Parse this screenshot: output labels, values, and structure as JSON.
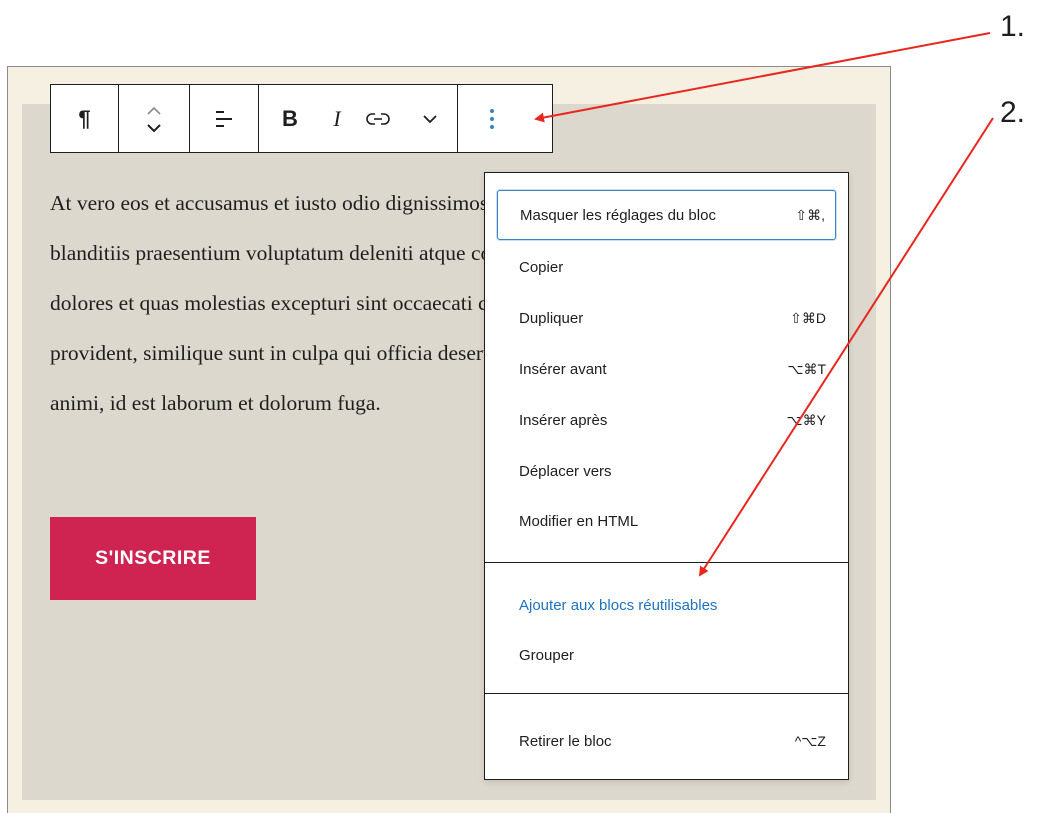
{
  "annotations": {
    "step1": "1.",
    "step2": "2."
  },
  "toolbar": {
    "paragraph_icon": "¶",
    "bold_label": "B",
    "italic_label": "I"
  },
  "paragraph": {
    "lines": [
      "At vero eos et accusamus et iusto odio dignissimos ducimus qui",
      "blanditiis praesentium voluptatum deleniti atque corrupti quos",
      "dolores et quas molestias excepturi sint occaecati cupiditate non",
      "provident, similique sunt in culpa qui officia deserunt mollitia",
      "animi, id est laborum et dolorum fuga."
    ]
  },
  "button": {
    "label": "S'INSCRIRE"
  },
  "menu": {
    "items": [
      {
        "label": "Masquer les réglages du bloc",
        "shortcut": "⇧⌘,",
        "focused": true
      },
      {
        "label": "Copier",
        "shortcut": ""
      },
      {
        "label": "Dupliquer",
        "shortcut": "⇧⌘D"
      },
      {
        "label": "Insérer avant",
        "shortcut": "⌥⌘T"
      },
      {
        "label": "Insérer après",
        "shortcut": "⌥⌘Y"
      },
      {
        "label": "Déplacer vers",
        "shortcut": ""
      },
      {
        "label": "Modifier en HTML",
        "shortcut": ""
      },
      {
        "label": "Ajouter aux blocs réutilisables",
        "shortcut": "",
        "accent": true
      },
      {
        "label": "Grouper",
        "shortcut": ""
      },
      {
        "label": "Retirer le bloc",
        "shortcut": "^⌥Z"
      }
    ]
  },
  "colors": {
    "accent": "#1e73be",
    "button": "#cf2351",
    "annotation_arrow": "#e8271f"
  }
}
